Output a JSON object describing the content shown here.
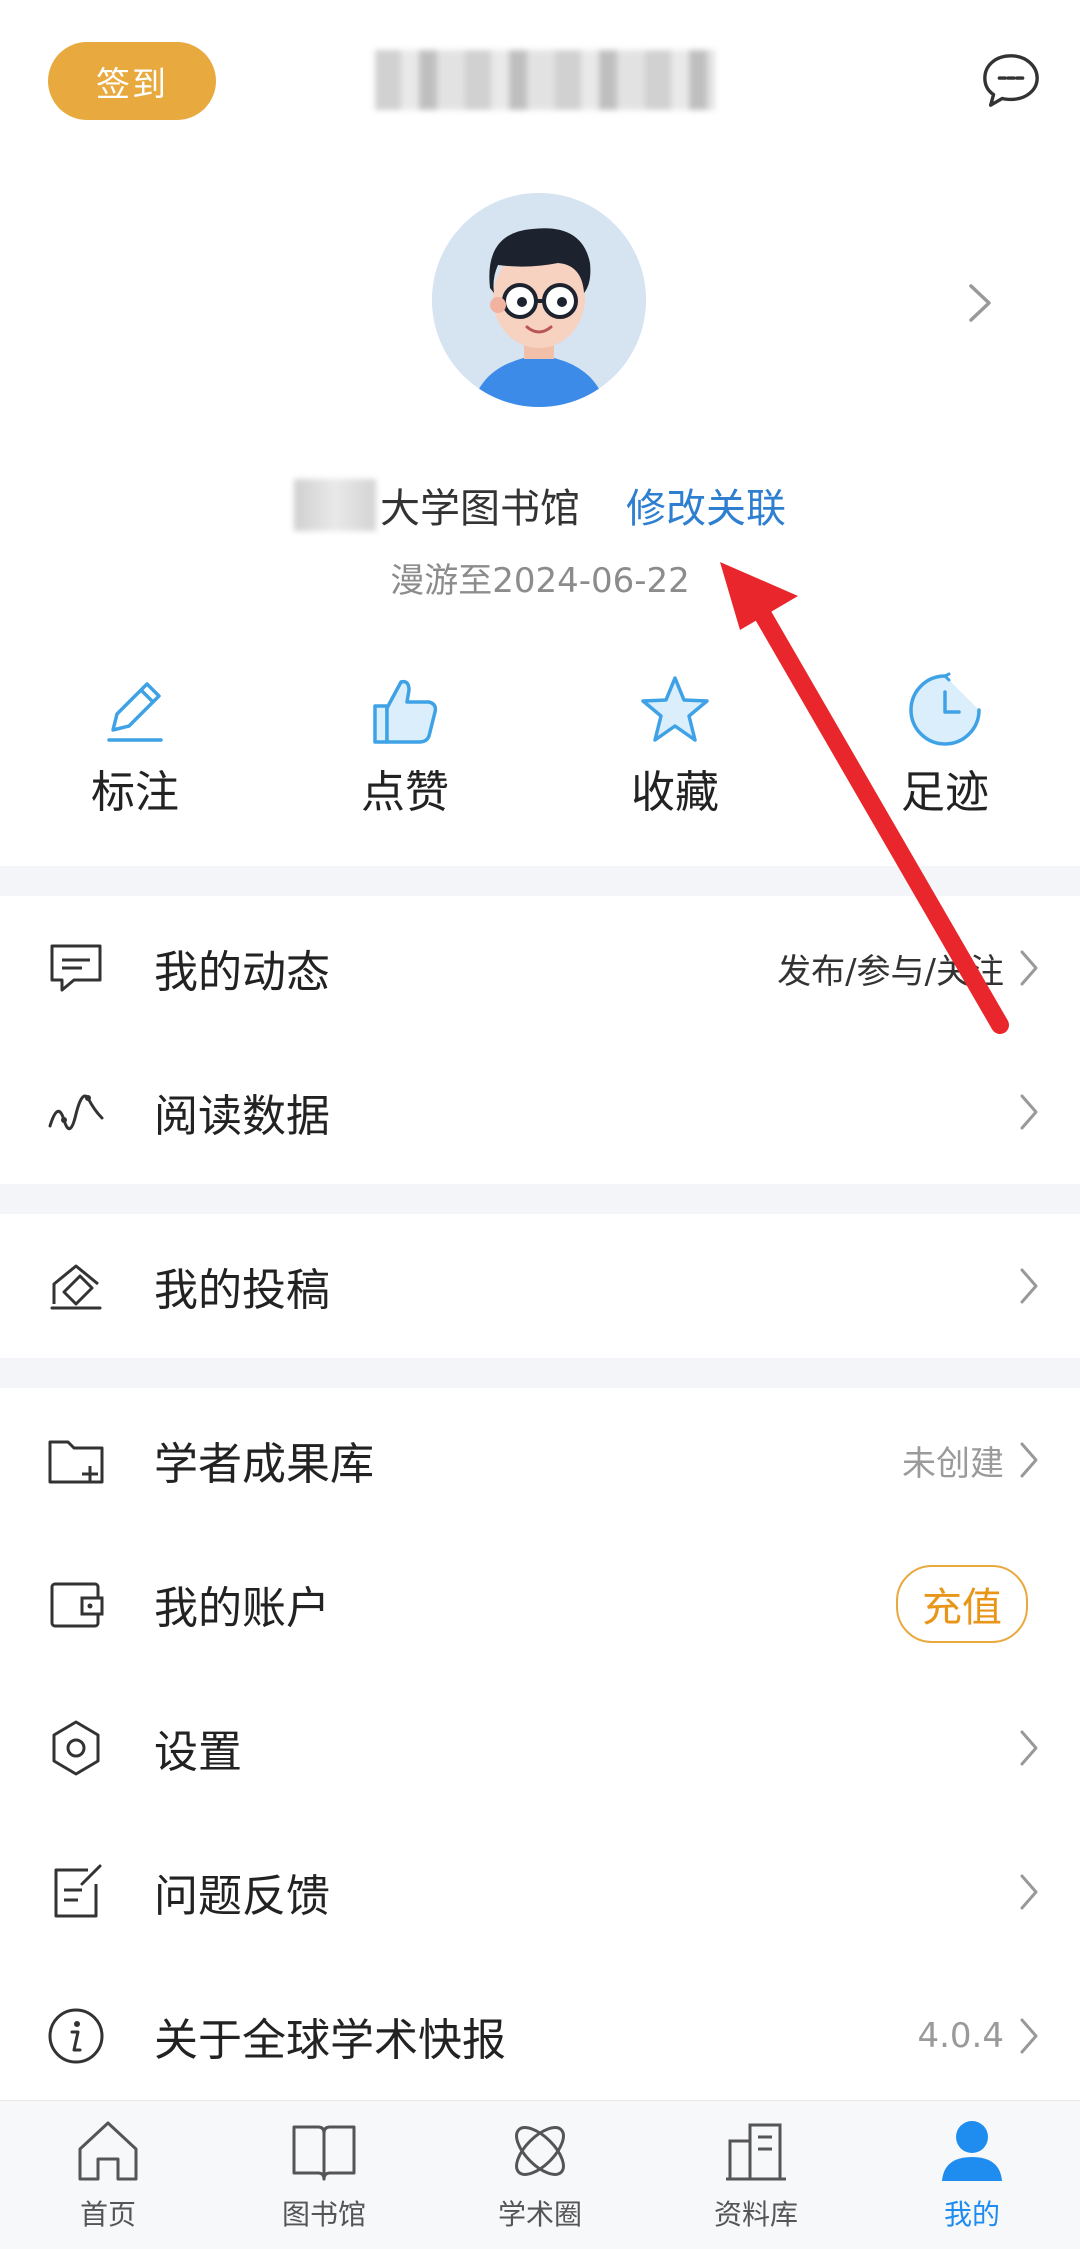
{
  "header": {
    "signin_label": "签到",
    "username_blurred": true
  },
  "profile": {
    "library_name": "大学图书馆",
    "edit_link": "修改关联",
    "roam_text": "漫游至2024-06-22"
  },
  "quick_actions": [
    {
      "label": "标注",
      "icon": "pencil-icon"
    },
    {
      "label": "点赞",
      "icon": "thumbs-up-icon"
    },
    {
      "label": "收藏",
      "icon": "star-icon"
    },
    {
      "label": "足迹",
      "icon": "clock-icon"
    }
  ],
  "menu": {
    "dynamics": {
      "label": "我的动态",
      "hint": "发布/参与/关注",
      "icon": "chat-icon"
    },
    "reading": {
      "label": "阅读数据",
      "icon": "wave-chart-icon"
    },
    "submission": {
      "label": "我的投稿",
      "icon": "envelope-icon"
    },
    "scholar": {
      "label": "学者成果库",
      "hint": "未创建",
      "icon": "folder-add-icon"
    },
    "account": {
      "label": "我的账户",
      "action": "充值",
      "icon": "wallet-icon"
    },
    "settings": {
      "label": "设置",
      "icon": "hexagon-settings-icon"
    },
    "feedback": {
      "label": "问题反馈",
      "icon": "feedback-icon"
    },
    "about": {
      "label": "关于全球学术快报",
      "hint": "4.0.4",
      "icon": "info-icon"
    }
  },
  "nav": [
    {
      "label": "首页",
      "icon": "home-icon",
      "active": false
    },
    {
      "label": "图书馆",
      "icon": "book-icon",
      "active": false
    },
    {
      "label": "学术圈",
      "icon": "orbit-icon",
      "active": false
    },
    {
      "label": "资料库",
      "icon": "buildings-icon",
      "active": false
    },
    {
      "label": "我的",
      "icon": "user-icon",
      "active": true
    }
  ],
  "colors": {
    "accent_blue": "#1f8cf0",
    "link_blue": "#2f7fd1",
    "signin_orange": "#e8a93f",
    "arrow_red": "#e8262b"
  }
}
